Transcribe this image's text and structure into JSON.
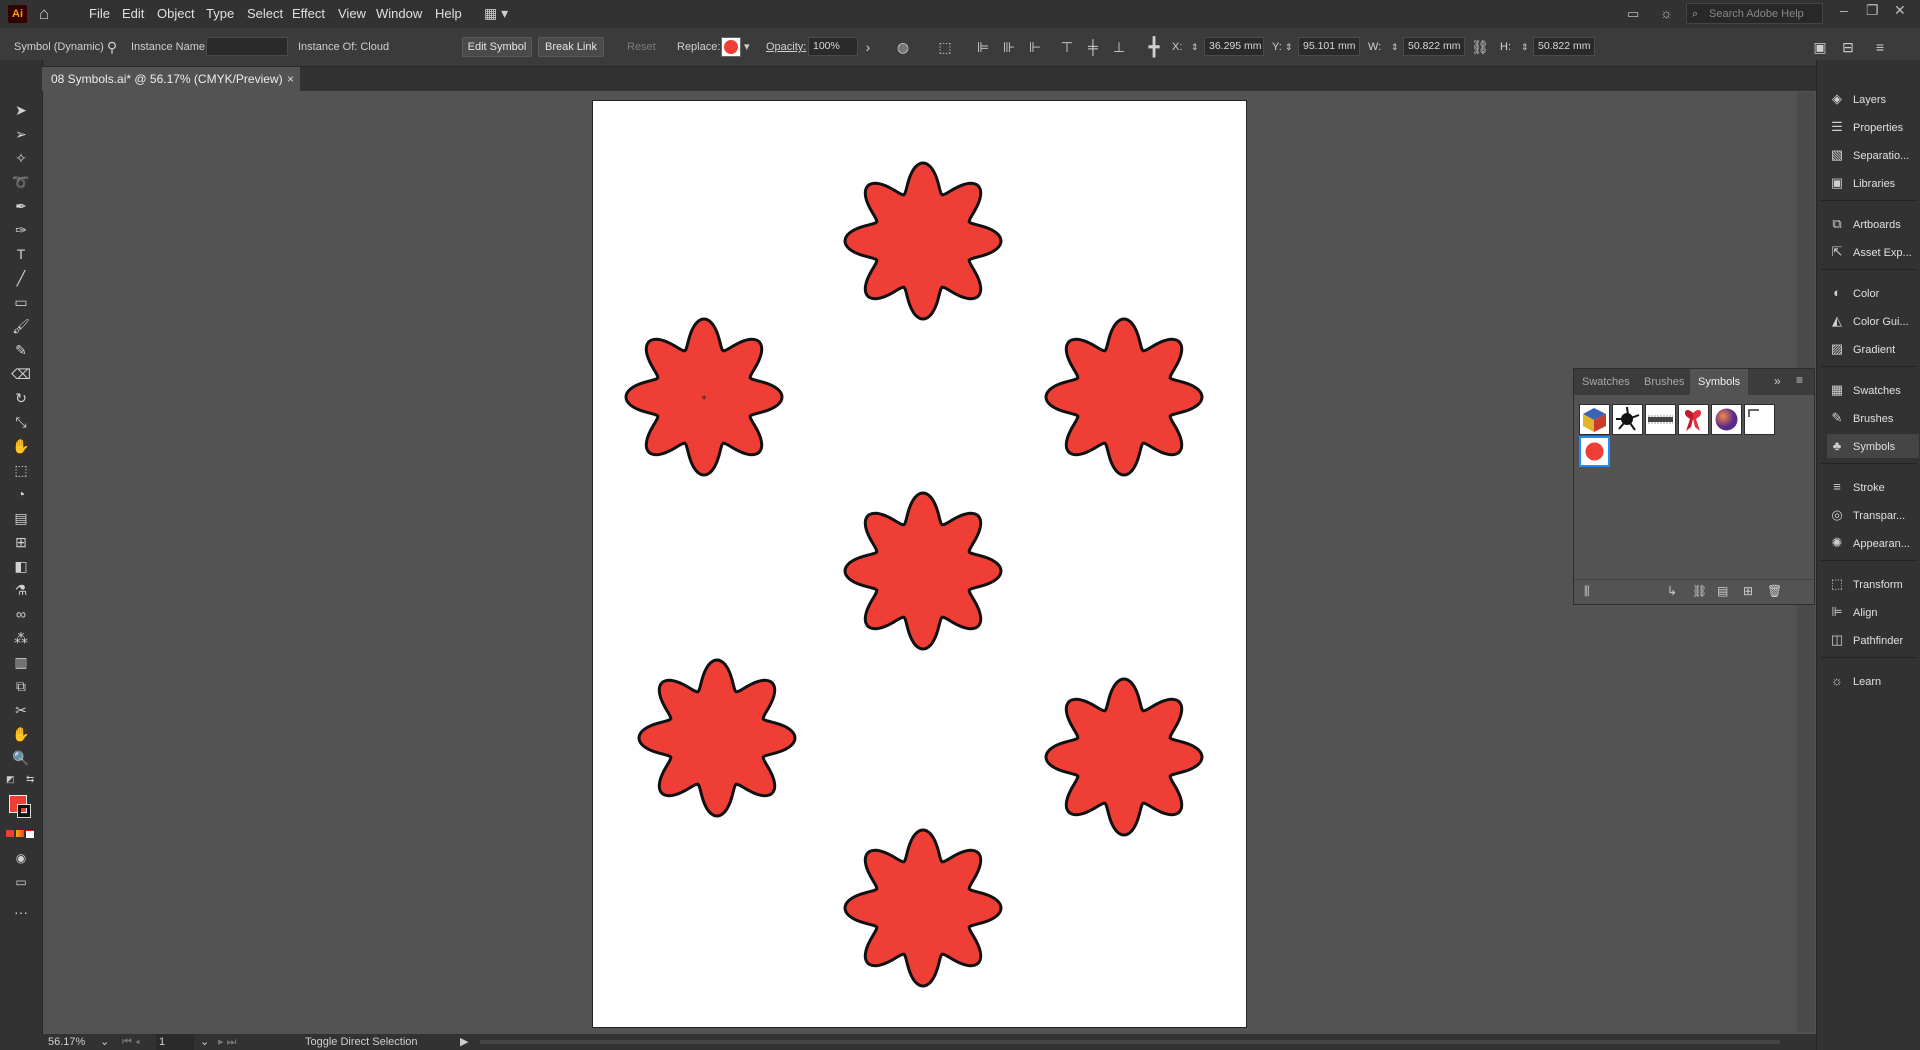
{
  "app": {
    "logo": "Ai",
    "home_icon": "home-icon"
  },
  "menu": [
    "File",
    "Edit",
    "Object",
    "Type",
    "Select",
    "Effect",
    "View",
    "Window",
    "Help"
  ],
  "search_placeholder": "Search Adobe Help",
  "control": {
    "selection_type": "Symbol (Dynamic)",
    "instance_name_label": "Instance Name:",
    "instance_name_value": "",
    "instance_of": "Instance Of: Cloud",
    "edit_symbol": "Edit Symbol",
    "break_link": "Break Link",
    "reset": "Reset",
    "replace_label": "Replace:",
    "opacity_label": "Opacity:",
    "opacity_value": "100%",
    "x_label": "X:",
    "x_value": "36.295 mm",
    "y_label": "Y:",
    "y_value": "95.101 mm",
    "w_label": "W:",
    "w_value": "50.822 mm",
    "h_label": "H:",
    "h_value": "50.822 mm"
  },
  "document": {
    "tab_title": "08 Symbols.ai* @ 56.17% (CMYK/Preview)",
    "close": "×"
  },
  "status": {
    "zoom": "56.17%",
    "artboard": "1",
    "tool_hint": "Toggle Direct Selection"
  },
  "symbols_panel": {
    "tabs": [
      "Swatches",
      "Brushes",
      "Symbols"
    ],
    "active_tab": "Symbols",
    "symbols": [
      "cube",
      "splat",
      "grunge",
      "ribbon",
      "sphere",
      "corner",
      "flower"
    ]
  },
  "dock": [
    {
      "label": "Layers",
      "icon": "layers-icon"
    },
    {
      "label": "Properties",
      "icon": "properties-icon"
    },
    {
      "label": "Separatio...",
      "icon": "separations-icon"
    },
    {
      "label": "Libraries",
      "icon": "libraries-icon"
    },
    {
      "label": "Artboards",
      "icon": "artboards-icon"
    },
    {
      "label": "Asset Exp...",
      "icon": "asset-export-icon"
    },
    {
      "label": "Color",
      "icon": "color-icon"
    },
    {
      "label": "Color Gui...",
      "icon": "color-guide-icon"
    },
    {
      "label": "Gradient",
      "icon": "gradient-icon"
    },
    {
      "label": "Swatches",
      "icon": "swatches-icon"
    },
    {
      "label": "Brushes",
      "icon": "brushes-icon"
    },
    {
      "label": "Symbols",
      "icon": "symbols-icon"
    },
    {
      "label": "Stroke",
      "icon": "stroke-icon"
    },
    {
      "label": "Transpar...",
      "icon": "transparency-icon"
    },
    {
      "label": "Appearan...",
      "icon": "appearance-icon"
    },
    {
      "label": "Transform",
      "icon": "transform-icon"
    },
    {
      "label": "Align",
      "icon": "align-icon"
    },
    {
      "label": "Pathfinder",
      "icon": "pathfinder-icon"
    },
    {
      "label": "Learn",
      "icon": "learn-icon"
    }
  ],
  "colors": {
    "flower_fill": "#ef3e36",
    "flower_stroke": "#111111",
    "ui_dark": "#323232",
    "canvas": "#535353"
  },
  "flowers": 7
}
